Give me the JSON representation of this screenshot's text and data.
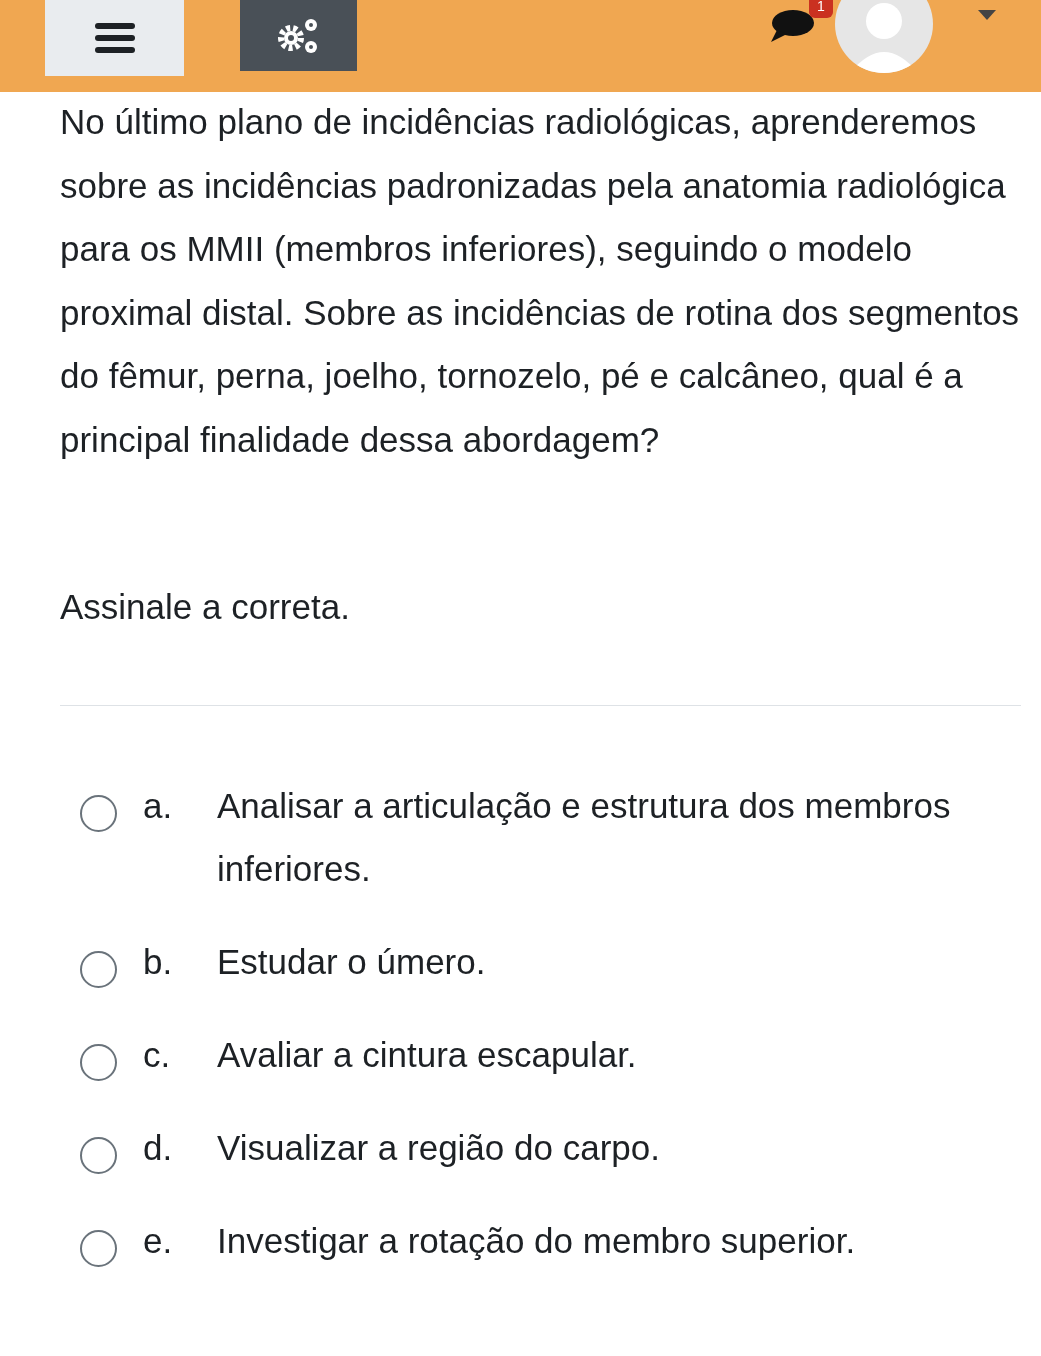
{
  "header": {
    "notification_count": "1"
  },
  "question": {
    "text": "No último plano de incidências radiológicas, aprenderemos sobre as incidências padronizadas pela anatomia radiológica para os MMII (membros inferiores), seguindo o modelo proximal distal. Sobre as incidências de rotina dos segmentos do fêmur, perna, joelho, tornozelo, pé e calcâneo, qual é a principal finalidade dessa abordagem?",
    "instruction": "Assinale a correta."
  },
  "options": [
    {
      "letter": "a.",
      "text": "Analisar a articulação e estrutura dos membros inferiores.",
      "selected": false
    },
    {
      "letter": "b.",
      "text": "Estudar o úmero.",
      "selected": false
    },
    {
      "letter": "c.",
      "text": "Avaliar a cintura escapular.",
      "selected": false
    },
    {
      "letter": "d.",
      "text": "Visualizar a região do carpo.",
      "selected": false
    },
    {
      "letter": "e.",
      "text": "Investigar a rotação do membro superior.",
      "selected": false
    }
  ]
}
